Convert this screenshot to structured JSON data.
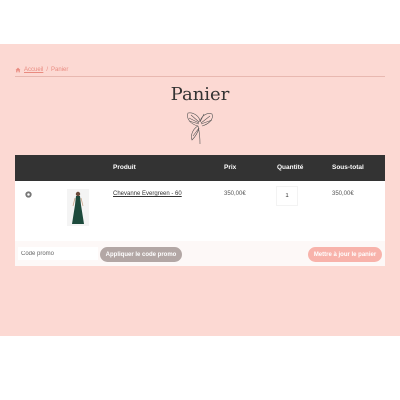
{
  "breadcrumb": {
    "home": "Accueil",
    "separator": "/",
    "current": "Panier"
  },
  "page": {
    "title": "Panier"
  },
  "cart": {
    "headers": {
      "remove": "",
      "thumbnail": "",
      "product": "Produit",
      "price": "Prix",
      "quantity": "Quantité",
      "subtotal": "Sous-total"
    },
    "items": [
      {
        "product": "Chevanne Evergreen - 60",
        "price": "350,00€",
        "quantity": "1",
        "subtotal": "350,00€"
      }
    ]
  },
  "actions": {
    "coupon_placeholder": "Code promo",
    "apply_label": "Appliquer le code promo",
    "update_label": "Mettre à jour le panier"
  },
  "colors": {
    "accent": "#e98b80",
    "header": "#333333",
    "background": "#fcd9d3"
  }
}
